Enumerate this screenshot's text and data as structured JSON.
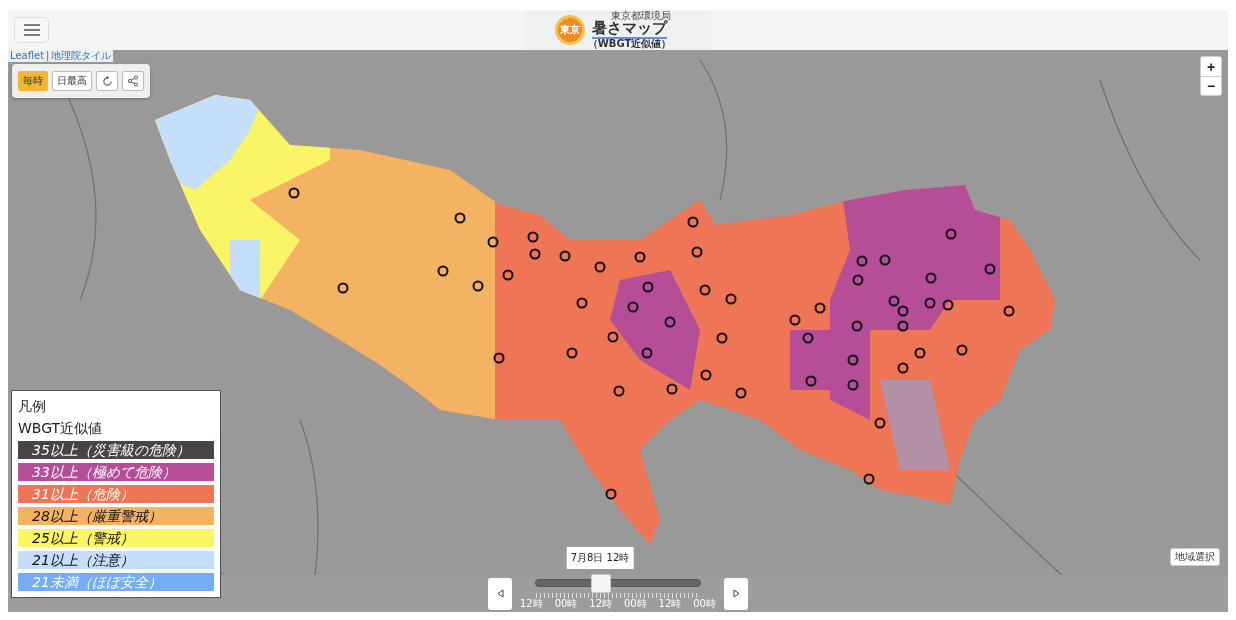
{
  "header": {
    "logo": {
      "badge": "東京",
      "agency": "東京都環境局",
      "title": "暑さマップ",
      "subtitle": "（WBGT近似値）"
    }
  },
  "attribution": {
    "link": "Leaflet",
    "separator": "|",
    "source": "地理院タイル"
  },
  "mode_buttons": [
    {
      "label": "毎時",
      "selected": true
    },
    {
      "label": "日最高",
      "selected": false
    }
  ],
  "zoom": {
    "in": "+",
    "out": "−"
  },
  "legend": {
    "title": "凡例",
    "subtitle": "WBGT近似値",
    "items": [
      {
        "label": "35以上（災害級の危険）",
        "color": "#4a4448"
      },
      {
        "label": "33以上（極めて危険）",
        "color": "#b54e97"
      },
      {
        "label": "31以上（危険）",
        "color": "#ee7556"
      },
      {
        "label": "28以上（厳重警戒）",
        "color": "#f4b263"
      },
      {
        "label": "25以上（警戒）",
        "color": "#faf566"
      },
      {
        "label": "21以上（注意）",
        "color": "#c5def9"
      },
      {
        "label": "21未満（ほぼ安全）",
        "color": "#74acf6"
      }
    ]
  },
  "time_slider": {
    "current": "7月8日 12時",
    "level": 0.39,
    "ticks": [
      "12時",
      "00時",
      "12時",
      "00時",
      "12時",
      "00時"
    ]
  },
  "region_button": "地域選択"
}
